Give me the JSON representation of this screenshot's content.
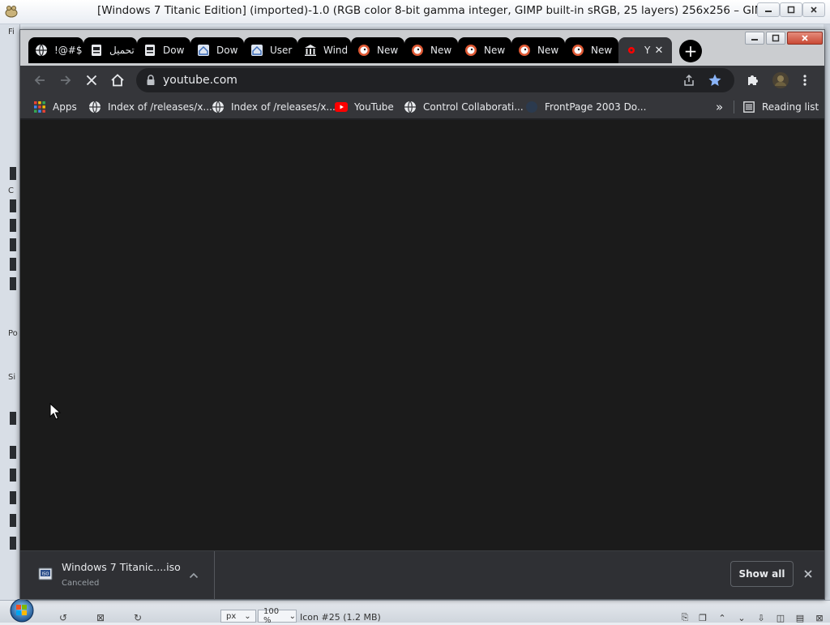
{
  "gimp": {
    "title": "[Windows 7 Titanic Edition] (imported)-1.0 (RGB color 8-bit gamma integer, GIMP built-in sRGB, 25 layers) 256x256 – GIMP",
    "left_strip_labels": [
      "Fi",
      "C",
      "Po",
      "Si"
    ],
    "status": {
      "unit": "px",
      "zoom": "100 %",
      "image_info": "Icon #25 (1.2 MB)"
    }
  },
  "chrome": {
    "tabs": [
      {
        "title": "!@#$",
        "icon": "globe-icon"
      },
      {
        "title": "تحميل",
        "icon": "document-icon"
      },
      {
        "title": "Dow",
        "icon": "document-icon"
      },
      {
        "title": "Dow",
        "icon": "house-icon"
      },
      {
        "title": "User",
        "icon": "house-icon"
      },
      {
        "title": "Wind",
        "icon": "building-icon"
      },
      {
        "title": "New",
        "icon": "duckduckgo-icon"
      },
      {
        "title": "New",
        "icon": "duckduckgo-icon"
      },
      {
        "title": "New",
        "icon": "duckduckgo-icon"
      },
      {
        "title": "New",
        "icon": "duckduckgo-icon"
      },
      {
        "title": "New",
        "icon": "duckduckgo-icon"
      },
      {
        "title": "Y",
        "icon": "youtube-icon",
        "active": true
      }
    ],
    "new_tab_symbol": "+",
    "omnibox": {
      "url": "youtube.com"
    },
    "bookmarks": [
      {
        "label": "Apps",
        "icon": "apps-grid-icon"
      },
      {
        "label": "Index of /releases/x...",
        "icon": "globe-icon"
      },
      {
        "label": "Index of /releases/x...",
        "icon": "globe-icon"
      },
      {
        "label": "YouTube",
        "icon": "youtube-icon"
      },
      {
        "label": "Control Collaborati...",
        "icon": "globe-icon"
      },
      {
        "label": "FrontPage 2003 Do...",
        "icon": "frontpage-icon"
      }
    ],
    "bookmarks_overflow": "»",
    "reading_list": "Reading list",
    "download": {
      "filename": "Windows 7 Titanic....iso",
      "status": "Canceled"
    },
    "show_all": "Show all",
    "colors": {
      "tab_bg": "#000000",
      "toolbar_bg": "#35363a",
      "content_bg": "#1b1b1b",
      "star_blue": "#8ab4f8"
    }
  }
}
